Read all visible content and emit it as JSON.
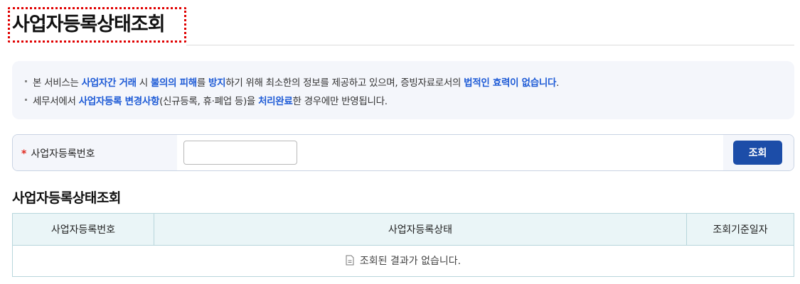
{
  "page": {
    "title": "사업자등록상태조회"
  },
  "notice": {
    "line1": [
      {
        "text": "본 서비스는 ",
        "hl": false
      },
      {
        "text": "사업자간 거래",
        "hl": true
      },
      {
        "text": " 시 ",
        "hl": false
      },
      {
        "text": "불의의 피해",
        "hl": true
      },
      {
        "text": "를 ",
        "hl": false
      },
      {
        "text": "방지",
        "hl": true
      },
      {
        "text": "하기 위해 최소한의 정보를 제공하고 있으며, 증빙자료로서의 ",
        "hl": false
      },
      {
        "text": "법적인 효력이 없습니다",
        "hl": true
      },
      {
        "text": ".",
        "hl": false
      }
    ],
    "line2": [
      {
        "text": "세무서에서 ",
        "hl": false
      },
      {
        "text": "사업자등록 변경사항",
        "hl": true
      },
      {
        "text": "(신규등록, 휴·폐업 등)을 ",
        "hl": false
      },
      {
        "text": "처리완료",
        "hl": true
      },
      {
        "text": "한 경우에만 반영됩니다.",
        "hl": false
      }
    ]
  },
  "search": {
    "label": "사업자등록번호",
    "required_mark": "*",
    "input_value": "",
    "button_label": "조회"
  },
  "results": {
    "section_title": "사업자등록상태조회",
    "columns": [
      "사업자등록번호",
      "사업자등록상태",
      "조회기준일자"
    ],
    "empty_message": "조회된 결과가 없습니다."
  },
  "colors": {
    "accent": "#1e5bd6",
    "button": "#1c4da8",
    "required": "#e0281e",
    "table_header_bg": "#eaf5f7",
    "table_border": "#b8d6dc",
    "notice_bg": "#f4f6fb"
  }
}
